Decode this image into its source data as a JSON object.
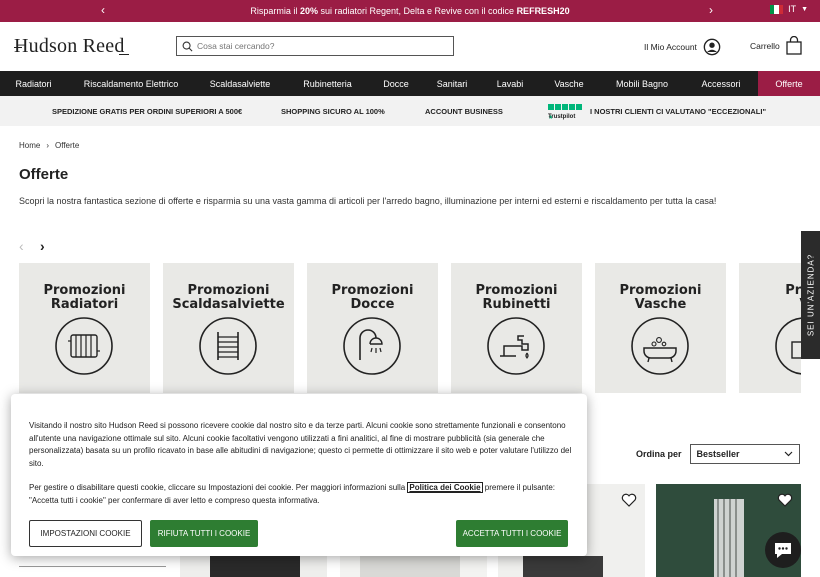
{
  "promo": {
    "text_prefix": "Risparmia il ",
    "discount": "20%",
    "text_mid": " sui radiatori Regent, Delta e Revive con il codice ",
    "code": "REFRESH20",
    "language": "IT"
  },
  "header": {
    "logo": "Hudson Reed",
    "search_placeholder": "Cosa stai cercando?",
    "account_label": "Il Mio Account",
    "cart_label": "Carrello"
  },
  "nav": {
    "items": [
      "Radiatori",
      "Riscaldamento Elettrico",
      "Scaldasalviette",
      "Rubinetteria",
      "Docce",
      "Sanitari",
      "Lavabi",
      "Vasche",
      "Mobili Bagno",
      "Accessori",
      "Offerte"
    ]
  },
  "usp": {
    "shipping": "SPEDIZIONE GRATIS PER ORDINI SUPERIORI A 500€",
    "secure": "SHOPPING SICURO AL 100%",
    "business": "ACCOUNT BUSINESS",
    "trustpilot": "Trustpilot",
    "reviews": "I NOSTRI CLIENTI CI VALUTANO \"ECCEZIONALI\""
  },
  "breadcrumb": {
    "home": "Home",
    "separator": "›",
    "current": "Offerte"
  },
  "page": {
    "title": "Offerte",
    "description": "Scopri la nostra fantastica sezione di offerte e risparmia su una vasta gamma di articoli per l'arredo bagno, illuminazione per interni ed esterni e riscaldamento per tutta la casa!"
  },
  "carousel": {
    "cards": [
      {
        "line1": "Promozioni",
        "line2": "Radiatori",
        "icon": "radiator-icon"
      },
      {
        "line1": "Promozioni",
        "line2": "Scaldasalviette",
        "icon": "towel-rail-icon"
      },
      {
        "line1": "Promozioni",
        "line2": "Docce",
        "icon": "shower-icon"
      },
      {
        "line1": "Promozioni",
        "line2": "Rubinetti",
        "icon": "tap-icon"
      },
      {
        "line1": "Promozioni",
        "line2": "Vasche",
        "icon": "bathtub-icon"
      },
      {
        "line1": "Prom",
        "line2": "V",
        "icon": "vanity-icon"
      }
    ]
  },
  "side_tab": "SEI UN'AZIENDA?",
  "sort": {
    "label": "Ordina per",
    "value": "Bestseller"
  },
  "cookie": {
    "paragraph1": "Visitando il nostro sito Hudson Reed si possono ricevere cookie dal nostro sito e da terze parti. Alcuni cookie sono strettamente funzionali e consentono all'utente una navigazione ottimale sul sito. Alcuni cookie facoltativi vengono utilizzati a fini analitici, al fine di mostrare pubblicità (sia generale che personalizzata) basata su un profilo ricavato in base alle abitudini di navigazione; questo ci permette di ottimizzare il sito web e poter valutare l'utilizzo del sito.",
    "paragraph2_pre": "Per gestire o disabilitare questi cookie, cliccare su Impostazioni dei cookie. Per maggiori informazioni sulla ",
    "policy_link": "Politica dei Cookie",
    "paragraph2_post": " premere il pulsante: \"Accetta tutti i cookie\" per confermare di aver letto e compreso questa informativa.",
    "settings_button": "IMPOSTAZIONI COOKIE",
    "reject_button": "RIFIUTA TUTTI I COOKIE",
    "accept_button": "ACCETTA TUTTI I COOKIE"
  },
  "colors": {
    "brand": "#9b1d45",
    "nav_bg": "#1e1e1e",
    "button_green": "#2e7d32"
  }
}
